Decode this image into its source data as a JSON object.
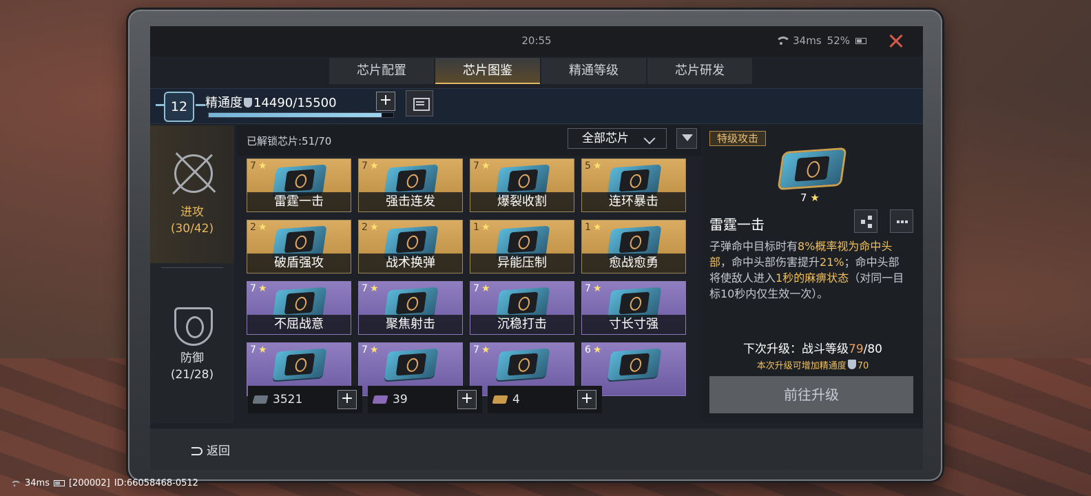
{
  "status": {
    "clock": "20:55",
    "ping": "34ms",
    "battery": "52%"
  },
  "tabs": [
    {
      "label": "芯片配置",
      "active": false
    },
    {
      "label": "芯片图鉴",
      "active": true
    },
    {
      "label": "精通等级",
      "active": false
    },
    {
      "label": "芯片研发",
      "active": false
    }
  ],
  "mastery": {
    "level": "12",
    "label": "精通度",
    "value": "14490/15500",
    "progress": 0.935
  },
  "categories": {
    "attack": {
      "name": "进攻",
      "count": "(30/42)",
      "selected": true
    },
    "defense": {
      "name": "防御",
      "count": "(21/28)",
      "selected": false
    }
  },
  "grid": {
    "unlocked": "已解锁芯片:51/70",
    "filter_value": "全部芯片",
    "cards": [
      {
        "stars": "7",
        "name": "雷霆一击",
        "rarity": "gold"
      },
      {
        "stars": "7",
        "name": "强击连发",
        "rarity": "gold"
      },
      {
        "stars": "7",
        "name": "爆裂收割",
        "rarity": "gold"
      },
      {
        "stars": "5",
        "name": "连环暴击",
        "rarity": "gold"
      },
      {
        "stars": "2",
        "name": "破盾强攻",
        "rarity": "gold"
      },
      {
        "stars": "2",
        "name": "战术换弹",
        "rarity": "gold"
      },
      {
        "stars": "1",
        "name": "异能压制",
        "rarity": "gold"
      },
      {
        "stars": "1",
        "name": "愈战愈勇",
        "rarity": "gold"
      },
      {
        "stars": "7",
        "name": "不屈战意",
        "rarity": "purple"
      },
      {
        "stars": "7",
        "name": "聚焦射击",
        "rarity": "purple"
      },
      {
        "stars": "7",
        "name": "沉稳打击",
        "rarity": "purple"
      },
      {
        "stars": "7",
        "name": "寸长寸强",
        "rarity": "purple"
      },
      {
        "stars": "7",
        "name": "",
        "rarity": "purple"
      },
      {
        "stars": "7",
        "name": "",
        "rarity": "purple"
      },
      {
        "stars": "7",
        "name": "",
        "rarity": "purple"
      },
      {
        "stars": "6",
        "name": "",
        "rarity": "purple"
      }
    ]
  },
  "resources": [
    {
      "value": "3521",
      "icon": "silver-chip-icon"
    },
    {
      "value": "39",
      "icon": "purple-chip-icon"
    },
    {
      "value": "4",
      "icon": "gold-chip-icon"
    }
  ],
  "detail": {
    "rarity": "特级攻击",
    "stars": "7",
    "name": "雷霆一击",
    "desc_parts": [
      {
        "t": "子弹命中目标时有",
        "h": false
      },
      {
        "t": "8%概率视为命中头部",
        "h": true
      },
      {
        "t": "，命中头部伤害提升",
        "h": false
      },
      {
        "t": "21%",
        "h": true
      },
      {
        "t": "；命中头部将使敌人进入",
        "h": false
      },
      {
        "t": "1秒的麻痹状态",
        "h": true
      },
      {
        "t": "（对同一目标10秒内仅生效一次）。",
        "h": false
      }
    ],
    "next_label": "下次升级：战斗等级",
    "next_cur": "79",
    "next_max": "/80",
    "bonus_text": "本次升级可增加精通度",
    "bonus_value": "70",
    "go_button": "前往升级"
  },
  "bottom": {
    "back": "返回"
  },
  "overlay": {
    "ping": "34ms",
    "server": "[200002]",
    "id": "ID:66058468-0512"
  }
}
